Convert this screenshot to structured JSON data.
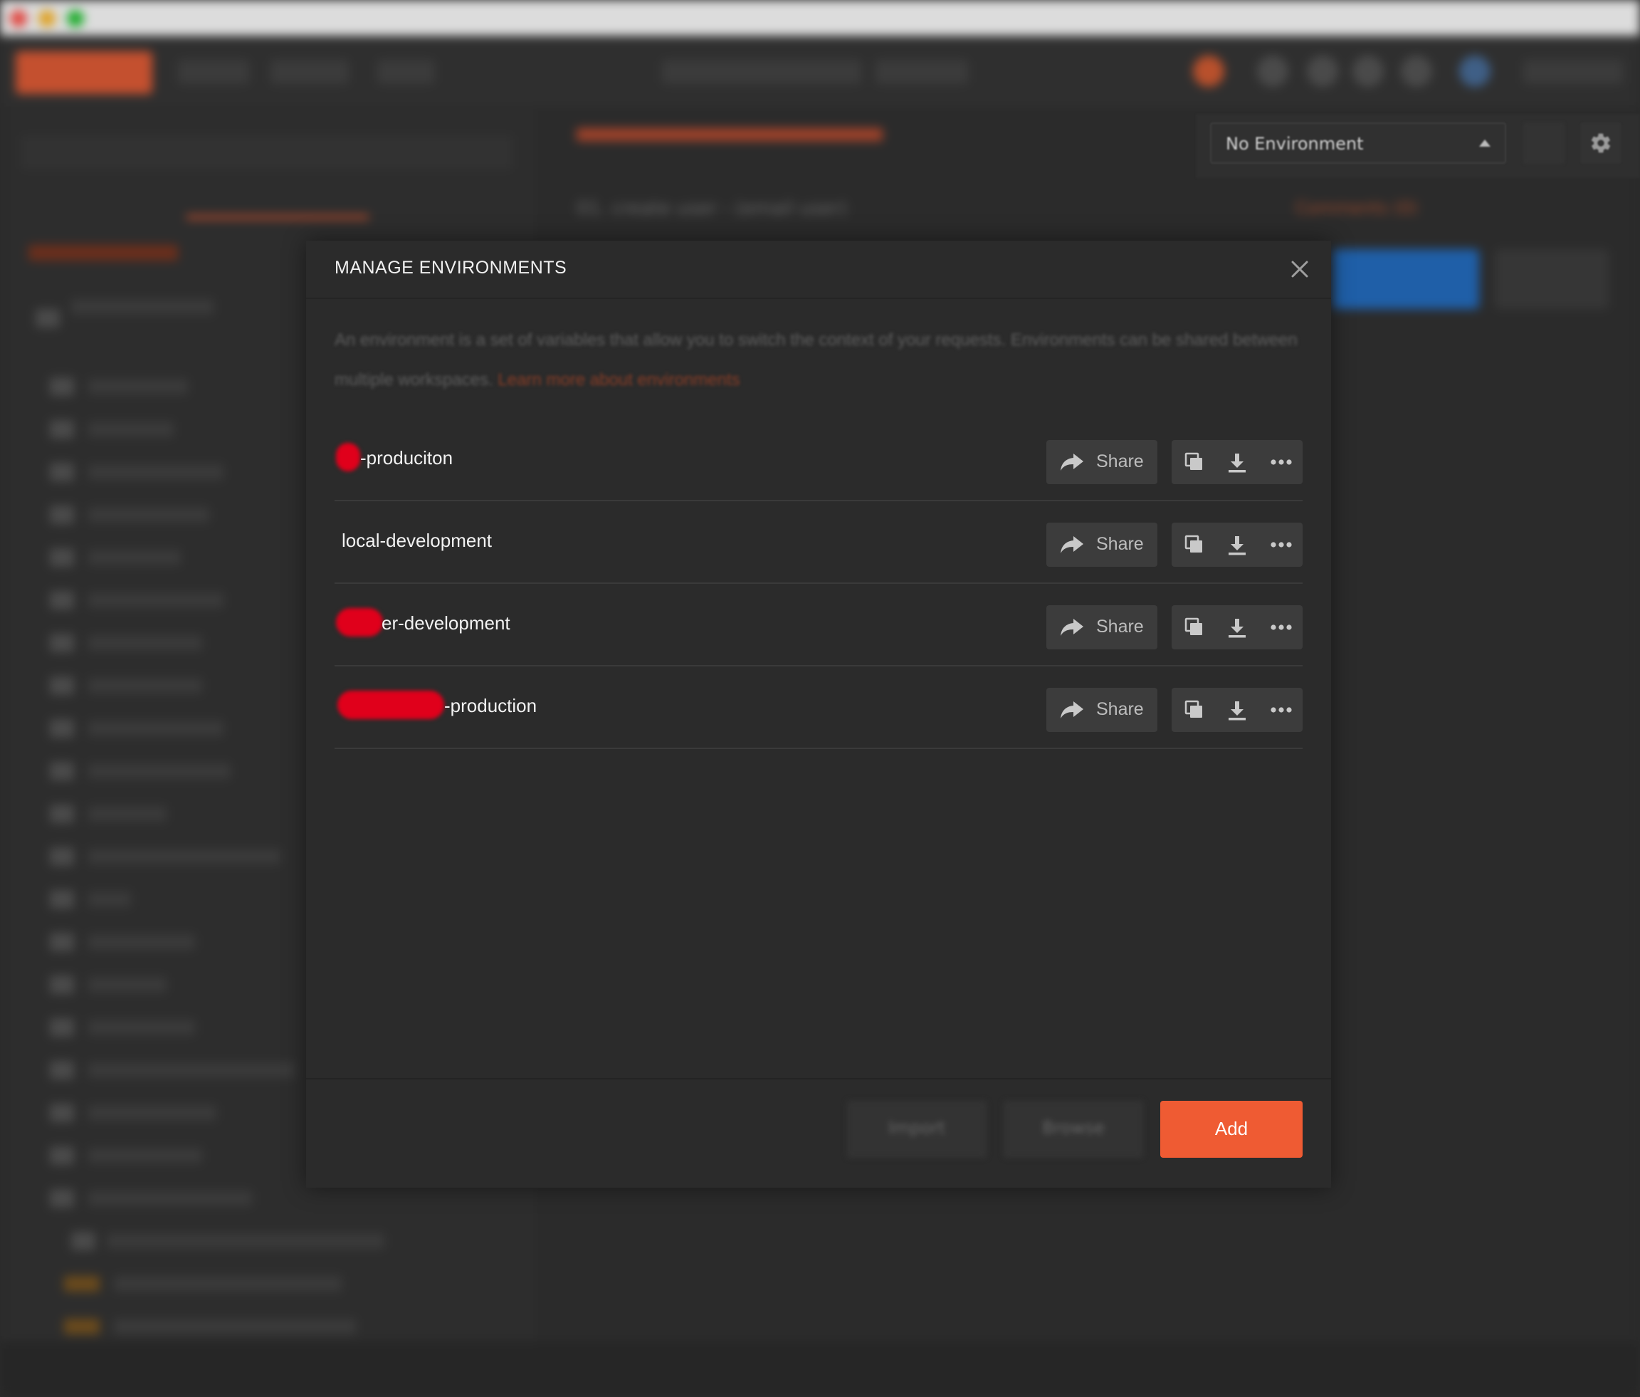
{
  "background": {
    "environment_selector": {
      "selected": "No Environment"
    },
    "comments_label": "Comments (0)",
    "request_title": "01. create user - (email user)"
  },
  "modal": {
    "title": "MANAGE ENVIRONMENTS",
    "description": "An environment is a set of variables that allow you to switch the context of your requests. Environments can be shared between multiple workspaces.",
    "learn_more": "Learn more about environments",
    "environments": [
      {
        "name": "-produciton",
        "share_label": "Share"
      },
      {
        "name": "local-development",
        "share_label": "Share"
      },
      {
        "name": "er-development",
        "share_label": "Share"
      },
      {
        "name": "-production",
        "share_label": "Share"
      }
    ],
    "footer": {
      "import_label": "Import",
      "browse_label": "Browse",
      "add_label": "Add"
    }
  },
  "colors": {
    "accent": "#ef5b33",
    "modal_bg": "#2b2b2b",
    "row_button_bg": "#3c3c3c",
    "redaction": "#e0001b"
  },
  "icons": {
    "close": "close-icon",
    "share": "share-arrow-icon",
    "duplicate": "duplicate-icon",
    "download": "download-icon",
    "more": "more-dots-icon",
    "settings": "gear-icon",
    "visibility": "eye-icon"
  }
}
